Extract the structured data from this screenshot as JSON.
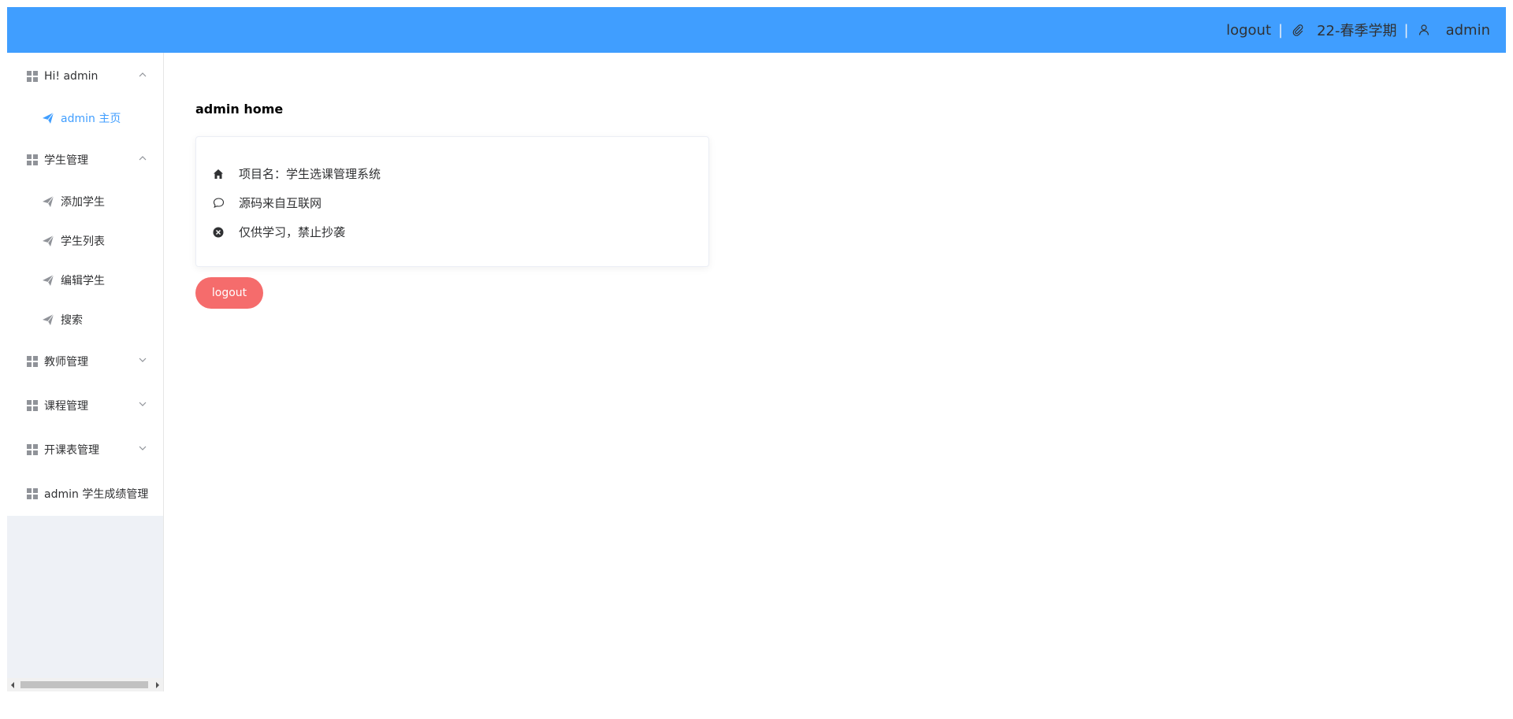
{
  "header": {
    "logout_label": "logout",
    "separator": "|",
    "semester_icon": "paperclip-icon",
    "semester": "22-春季学期",
    "user_icon": "user-icon",
    "username": "admin",
    "background_color": "#409eff"
  },
  "sidebar": {
    "groups": [
      {
        "label": "Hi! admin",
        "icon": "grid-icon",
        "expanded": true
      },
      {
        "label": "学生管理",
        "icon": "grid-icon",
        "expanded": true
      },
      {
        "label": "教师管理",
        "icon": "grid-icon",
        "expanded": false
      },
      {
        "label": "课程管理",
        "icon": "grid-icon",
        "expanded": false
      },
      {
        "label": "开课表管理",
        "icon": "grid-icon",
        "expanded": false
      },
      {
        "label": "admin 学生成绩管理",
        "icon": "grid-icon"
      }
    ],
    "subitems": [
      {
        "label": "admin 主页",
        "icon": "send-icon",
        "active": true
      },
      {
        "label": "添加学生",
        "icon": "send-icon"
      },
      {
        "label": "学生列表",
        "icon": "send-icon"
      },
      {
        "label": "编辑学生",
        "icon": "send-icon"
      },
      {
        "label": "搜索",
        "icon": "send-icon"
      }
    ],
    "active_color": "#409eff"
  },
  "main": {
    "title": "admin home",
    "card": {
      "rows": [
        {
          "icon": "home-icon",
          "text": "项目名：学生选课管理系统"
        },
        {
          "icon": "chat-bubble-icon",
          "text": "源码来自互联网"
        },
        {
          "icon": "circle-close-icon",
          "text": "仅供学习，禁止抄袭"
        }
      ]
    },
    "logout_button": "logout",
    "logout_color": "#f56c6c"
  }
}
